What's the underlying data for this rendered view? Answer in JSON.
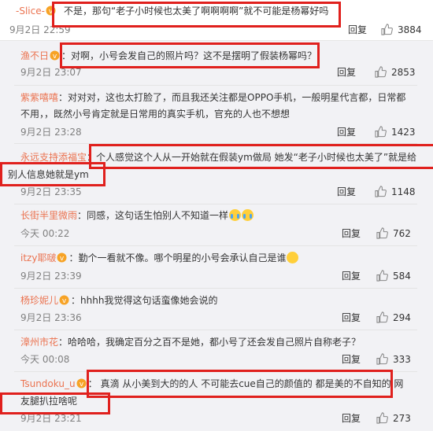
{
  "top": {
    "user": "-Slice-",
    "text": "不是，那句“老子小时候也太美了啊啊啊啊”就不可能是杨幂好吗",
    "time": "9月2日 22:59",
    "reply": "回复",
    "likes": "3884"
  },
  "comments": [
    {
      "user": "渔不日",
      "vip": true,
      "sep": "：",
      "text": "对啊，小号会发自己的照片吗？这不是摆明了假装杨幂吗？",
      "time": "9月2日 23:07",
      "reply": "回复",
      "likes": "2853"
    },
    {
      "user": "紫紫嘻嘻",
      "vip": false,
      "sep": "：",
      "text": "对对对，这也太打脸了，而且我还关注都是OPPO手机，一般明星代言都，日常都",
      "text2": "不用，，既然小号肯定就是日常用的真实手机，官充的人也不想想",
      "time": "9月2日 23:28",
      "reply": "回复",
      "likes": "1423"
    },
    {
      "user": "永远支持添福宝",
      "vip": false,
      "sep": "：",
      "text": "个人感觉这个人从一开始就在假装ym做局 她发“老子小时候也太美了”就是给",
      "text2": "别人信息她就是ym",
      "time": "9月2日 23:35",
      "reply": "回复",
      "likes": "1148"
    },
    {
      "user": "长街半里微雨",
      "vip": false,
      "sep": "：",
      "text": "同感，这句话生怕别人不知道一样",
      "emoji": "tear",
      "time": "今天 00:22",
      "reply": "回复",
      "likes": "762"
    },
    {
      "user": "itzy耶啵",
      "vip": true,
      "sep": "：",
      "text": "勤个一看就不像。哪个明星的小号会承认自己是谁",
      "emoji": "think",
      "time": "9月2日 23:39",
      "reply": "回复",
      "likes": "584"
    },
    {
      "user": "杨珍妮儿",
      "vip": true,
      "sep": "：",
      "text": "hhhh我觉得这句话蛮像她会说的",
      "time": "9月2日 23:36",
      "reply": "回复",
      "likes": "294"
    },
    {
      "user": "漳州市花",
      "vip": false,
      "sep": "：",
      "text": "哈哈哈，我确定百分之百不是她，都小号了还会发自己照片自称老子？",
      "time": "今天 00:08",
      "reply": "回复",
      "likes": "333"
    },
    {
      "user": "Tsundoku_u",
      "vip": true,
      "sep": "：",
      "text": "真滴 从小美到大的的人 不可能去cue自己的颜值的 都是美的不自知的 网",
      "text2": "友腿扒拉啥呢",
      "time": "9月2日 23:21",
      "reply": "回复",
      "likes": "273"
    }
  ],
  "colors": {
    "username": "#eb7350",
    "highlight": "#e0201d",
    "subBg": "#f2f2f5"
  }
}
